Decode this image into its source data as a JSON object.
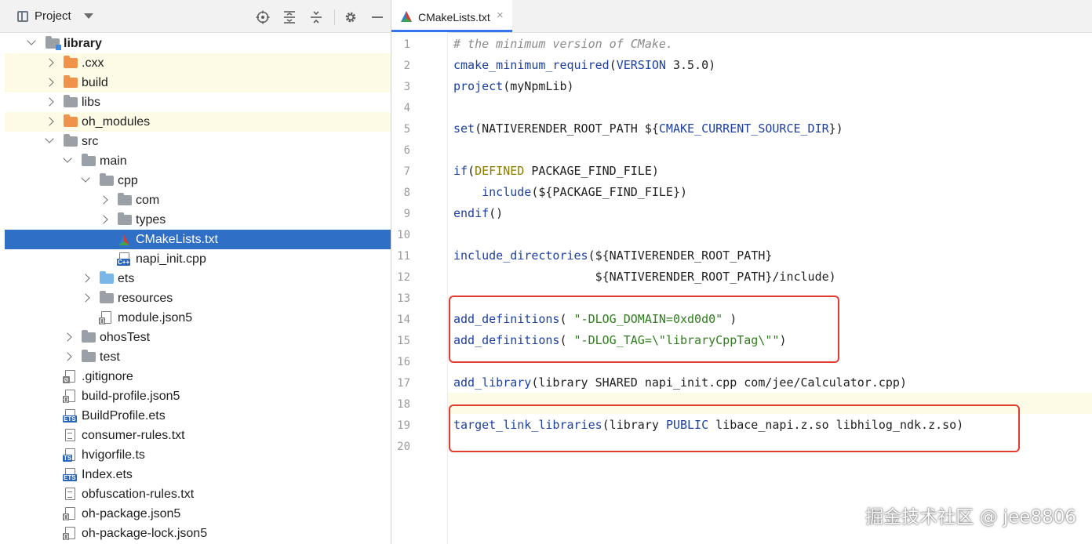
{
  "project_panel": {
    "title": "Project",
    "toolbar_icons": [
      "locate-icon",
      "expand-all-icon",
      "collapse-all-icon",
      "gear-icon",
      "minimize-icon"
    ]
  },
  "tree": [
    {
      "label": "library",
      "kind": "module",
      "expanded": true,
      "bold": true
    },
    {
      "label": ".cxx",
      "kind": "folder-orange",
      "expanded": false
    },
    {
      "label": "build",
      "kind": "folder-orange",
      "expanded": false
    },
    {
      "label": "libs",
      "kind": "folder",
      "expanded": false
    },
    {
      "label": "oh_modules",
      "kind": "folder-orange",
      "expanded": false
    },
    {
      "label": "src",
      "kind": "folder",
      "expanded": true
    },
    {
      "label": "main",
      "kind": "folder",
      "expanded": true
    },
    {
      "label": "cpp",
      "kind": "folder",
      "expanded": true
    },
    {
      "label": "com",
      "kind": "folder",
      "expanded": false
    },
    {
      "label": "types",
      "kind": "folder",
      "expanded": false
    },
    {
      "label": "CMakeLists.txt",
      "kind": "cmake",
      "selected": true
    },
    {
      "label": "napi_init.cpp",
      "kind": "cpp"
    },
    {
      "label": "ets",
      "kind": "folder-blue",
      "expanded": false
    },
    {
      "label": "resources",
      "kind": "folder",
      "expanded": false
    },
    {
      "label": "module.json5",
      "kind": "json5"
    },
    {
      "label": "ohosTest",
      "kind": "folder",
      "expanded": false
    },
    {
      "label": "test",
      "kind": "folder",
      "expanded": false
    },
    {
      "label": ".gitignore",
      "kind": "gitignore"
    },
    {
      "label": "build-profile.json5",
      "kind": "json5"
    },
    {
      "label": "BuildProfile.ets",
      "kind": "ets"
    },
    {
      "label": "consumer-rules.txt",
      "kind": "text"
    },
    {
      "label": "hvigorfile.ts",
      "kind": "ts"
    },
    {
      "label": "Index.ets",
      "kind": "ets"
    },
    {
      "label": "obfuscation-rules.txt",
      "kind": "text"
    },
    {
      "label": "oh-package.json5",
      "kind": "json5"
    },
    {
      "label": "oh-package-lock.json5",
      "kind": "json5"
    }
  ],
  "editor": {
    "tab_label": "CMakeLists.txt",
    "tab_close": "×",
    "line_numbers": [
      "1",
      "2",
      "3",
      "4",
      "5",
      "6",
      "7",
      "8",
      "9",
      "10",
      "11",
      "12",
      "13",
      "14",
      "15",
      "16",
      "17",
      "18",
      "19",
      "20"
    ],
    "lines": [
      "# the minimum version of CMake.",
      "cmake_minimum_required(VERSION 3.5.0)",
      "project(myNpmLib)",
      "",
      "set(NATIVERENDER_ROOT_PATH ${CMAKE_CURRENT_SOURCE_DIR})",
      "",
      "if(DEFINED PACKAGE_FIND_FILE)",
      "    include(${PACKAGE_FIND_FILE})",
      "endif()",
      "",
      "include_directories(${NATIVERENDER_ROOT_PATH}",
      "                    ${NATIVERENDER_ROOT_PATH}/include)",
      "",
      "add_definitions( \"-DLOG_DOMAIN=0xd0d0\" )",
      "add_definitions( \"-DLOG_TAG=\\\"libraryCppTag\\\"\")",
      "",
      "add_library(library SHARED napi_init.cpp com/jee/Calculator.cpp)",
      "",
      "target_link_libraries(library PUBLIC libace_napi.z.so libhilog_ndk.z.so)",
      ""
    ],
    "current_line": "18"
  },
  "watermark": "掘金技术社区 @ jee8806",
  "colors": {
    "selection": "#2f6fc6",
    "keyword": "#1c3fa3",
    "string": "#2f7d1d",
    "comment": "#8a8a8a",
    "highlight_box": "#e23b2f",
    "excluded_folder": "#fdfbe6"
  }
}
